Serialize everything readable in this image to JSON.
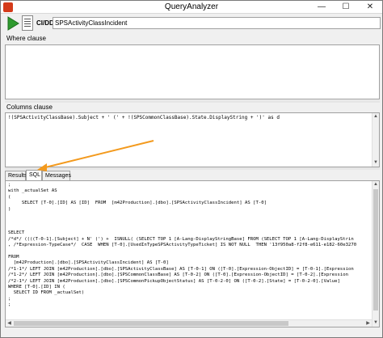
{
  "window": {
    "title": "QueryAnalyzer",
    "minimize_glyph": "—",
    "maximize_glyph": "☐",
    "close_glyph": "✕"
  },
  "toolbar": {
    "run_icon": "play-icon",
    "query_icon": "document-icon",
    "cidd_label": "CI/DD",
    "class_name": "SPSActivityClassIncident"
  },
  "where": {
    "label": "Where clause",
    "value": ""
  },
  "columns": {
    "label": "Columns clause",
    "value": "!(SPSActivityClassBase).Subject + ' (' + !(SPSCommonClassBase).State.DisplayString + ')' as d"
  },
  "tabs": [
    {
      "label": "Results"
    },
    {
      "label": "SQL"
    },
    {
      "label": "Messages"
    }
  ],
  "active_tab": "SQL",
  "sql_lines": [
    ";",
    "with _actualSet AS",
    "(",
    "     SELECT [T-0].[ID] AS [ID]  FROM  [m42Production].[dbo].[SPSActivityClassIncident] AS [T-0]",
    ")",
    "",
    "",
    "",
    "SELECT",
    "/*d*/ ((((T-0-1].[Subject] + N' (') +  ISNULL( (SELECT TOP 1 [A-Lang-DisplayStringBase] FROM (SELECT TOP 1 [A-Lang-DisplayStrin",
    ", /*Expression-TypeCase*/  CASE  WHEN [T-0].[UsedInTypeSPSActivityTypeTicket] IS NOT NULL  THEN '13f950a8-f2f8-e611-e182-60e3270",
    "",
    "FROM",
    "  [m42Production].[dbo].[SPSActivityClassIncident] AS [T-0]",
    "/*1-1*/ LEFT JOIN [m42Production].[dbo].[SPSActivityClassBase] AS [T-0-1] ON ([T-0].[Expression-ObjectID] = [T-0-1].[Expression",
    "/*1-2*/ LEFT JOIN [m42Production].[dbo].[SPSCommonClassBase] AS [T-0-2] ON ([T-0].[Expression-ObjectID] = [T-0-2].[Expression",
    "/*2-1*/ LEFT JOIN [m42Production].[dbo].[SPSCommonPickupObjectStatus] AS [T-0-2-0] ON ([T-0-2].[State] = [T-0-2-0].[Value]",
    "WHERE [T-0].[ID] IN (",
    "  SELECT ID FROM _actualSet)",
    ";",
    ";"
  ],
  "colors": {
    "arrow": "#f39a1e",
    "play": "#2e9a2e"
  }
}
